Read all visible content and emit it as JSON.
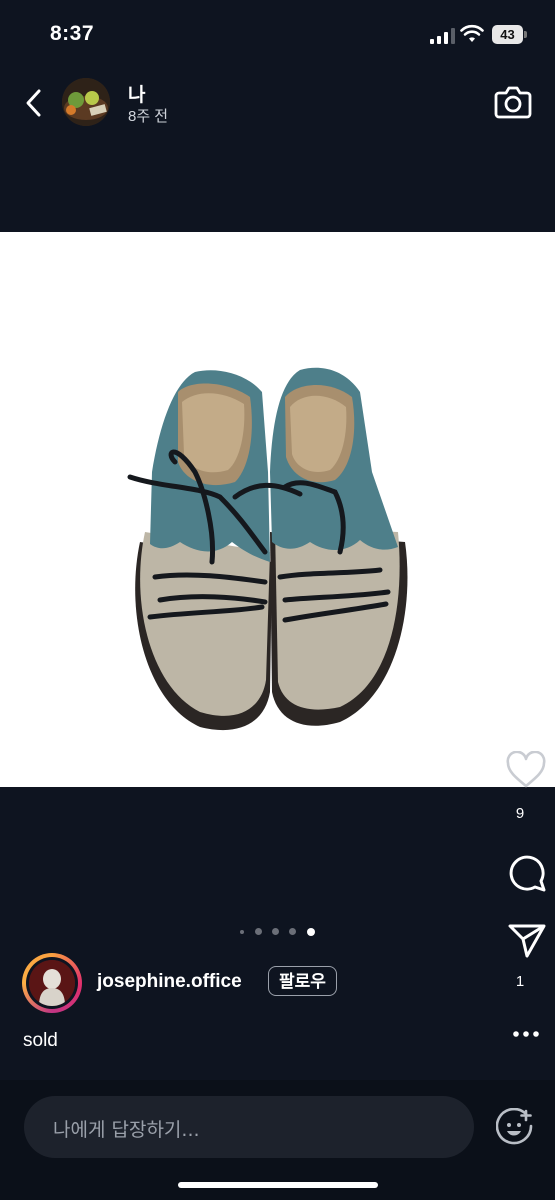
{
  "status_bar": {
    "time": "8:37",
    "battery": "43"
  },
  "header": {
    "username": "나",
    "timeago": "8주 전"
  },
  "media": {
    "carousel_total": 5,
    "carousel_active": 5
  },
  "actions": {
    "like_count": "9",
    "share_count": "1"
  },
  "author": {
    "name": "josephine.office",
    "follow_label": "팔로우"
  },
  "caption": {
    "text": "sold"
  },
  "reply": {
    "placeholder": "나에게 답장하기..."
  },
  "icons": [
    "back-icon",
    "camera-icon",
    "heart-icon",
    "reply-icon",
    "share-icon",
    "more-icon",
    "sticker-icon"
  ],
  "colors": {
    "background": "#0e1420",
    "media_bg": "#ffffff",
    "suede_blue": "#4e7f8a",
    "suede_taupe": "#bdb6a6"
  }
}
